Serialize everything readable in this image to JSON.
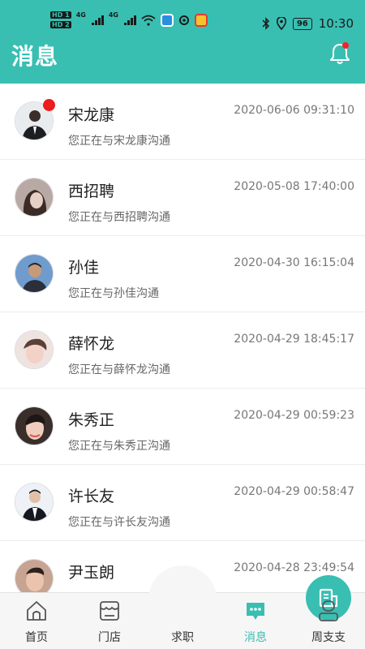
{
  "status_bar": {
    "hd_chips": [
      "HD 1",
      "HD 2"
    ],
    "signal_labels": [
      "4G",
      "4G"
    ],
    "battery": "96",
    "time": "10:30",
    "icons": [
      "wifi-icon",
      "app-icon",
      "weibo-like-icon",
      "bluetooth-icon",
      "location-icon"
    ]
  },
  "header": {
    "title": "消息",
    "bell_icon": "bell-icon",
    "has_unread": true
  },
  "messages": [
    {
      "name": "宋龙康",
      "preview": "您正在与宋龙康沟通",
      "time": "2020-06-06 09:31:10",
      "unread": true
    },
    {
      "name": "西招聘",
      "preview": "您正在与西招聘沟通",
      "time": "2020-05-08 17:40:00",
      "unread": false
    },
    {
      "name": "孙佳",
      "preview": "您正在与孙佳沟通",
      "time": "2020-04-30 16:15:04",
      "unread": false
    },
    {
      "name": "薛怀龙",
      "preview": "您正在与薛怀龙沟通",
      "time": "2020-04-29 18:45:17",
      "unread": false
    },
    {
      "name": "朱秀正",
      "preview": "您正在与朱秀正沟通",
      "time": "2020-04-29 00:59:23",
      "unread": false
    },
    {
      "name": "许长友",
      "preview": "您正在与许长友沟通",
      "time": "2020-04-29 00:58:47",
      "unread": false
    },
    {
      "name": "尹玉朗",
      "preview": "",
      "time": "2020-04-28 23:49:54",
      "unread": false
    }
  ],
  "tabs": [
    {
      "label": "首页",
      "icon": "home-icon",
      "active": false
    },
    {
      "label": "门店",
      "icon": "store-icon",
      "active": false
    },
    {
      "label": "求职",
      "icon": "job-icon",
      "active": false
    },
    {
      "label": "消息",
      "icon": "message-icon",
      "active": true
    },
    {
      "label": "周支支",
      "icon": "profile-icon",
      "active": false
    }
  ],
  "colors": {
    "accent": "#38bfb2",
    "unread_dot": "#ee1c1c"
  }
}
